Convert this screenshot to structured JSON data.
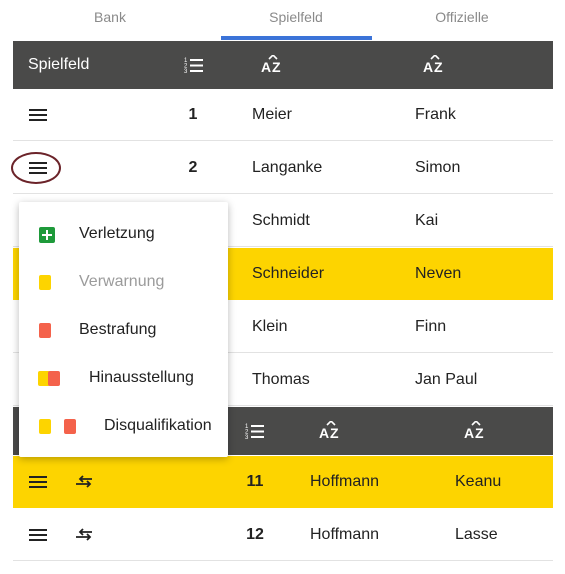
{
  "tabs": [
    {
      "label": "Bank"
    },
    {
      "label": "Spielfeld"
    },
    {
      "label": "Offizielle"
    }
  ],
  "active_tab": "Spielfeld",
  "colors": {
    "header_bg": "#4a4a49",
    "highlight_row": "#fdd400",
    "tab_indicator": "#3b73d8",
    "ring": "#6b2329",
    "card_yellow": "#fdd400",
    "card_red": "#f4624b",
    "plus_green": "#1e9a3a"
  },
  "field_table": {
    "title": "Spielfeld",
    "header_icons": [
      "list-numbered-icon",
      "sort-az-icon",
      "sort-az-icon"
    ],
    "rows": [
      {
        "number": "1",
        "last_name": "Meier",
        "first_name": "Frank",
        "highlighted": false
      },
      {
        "number": "2",
        "last_name": "Langanke",
        "first_name": "Simon",
        "highlighted": false
      },
      {
        "number": "",
        "last_name": "Schmidt",
        "first_name": "Kai",
        "highlighted": false
      },
      {
        "number": "",
        "last_name": "Schneider",
        "first_name": "Neven",
        "highlighted": true
      },
      {
        "number": "",
        "last_name": "Klein",
        "first_name": "Finn",
        "highlighted": false
      },
      {
        "number": "",
        "last_name": "Thomas",
        "first_name": "Jan Paul",
        "highlighted": false
      }
    ]
  },
  "bench_table": {
    "header_icons": [
      "list-numbered-icon",
      "sort-az-icon",
      "sort-az-icon"
    ],
    "rows": [
      {
        "number": "11",
        "last_name": "Hoffmann",
        "first_name": "Keanu",
        "highlighted": true
      },
      {
        "number": "12",
        "last_name": "Hoffmann",
        "first_name": "Lasse",
        "highlighted": false
      }
    ]
  },
  "context_menu": {
    "items": [
      {
        "label": "Verletzung",
        "icon": "plus-icon",
        "enabled": true
      },
      {
        "label": "Verwarnung",
        "icon": "yellow-card-icon",
        "enabled": false
      },
      {
        "label": "Bestrafung",
        "icon": "red-card-icon",
        "enabled": true
      },
      {
        "label": "Hinausstellung",
        "icon": "yellow-red-card-icon",
        "enabled": true
      },
      {
        "label": "Disqualifikation",
        "icon": "yellow-and-red-cards-icon",
        "enabled": true
      }
    ]
  }
}
